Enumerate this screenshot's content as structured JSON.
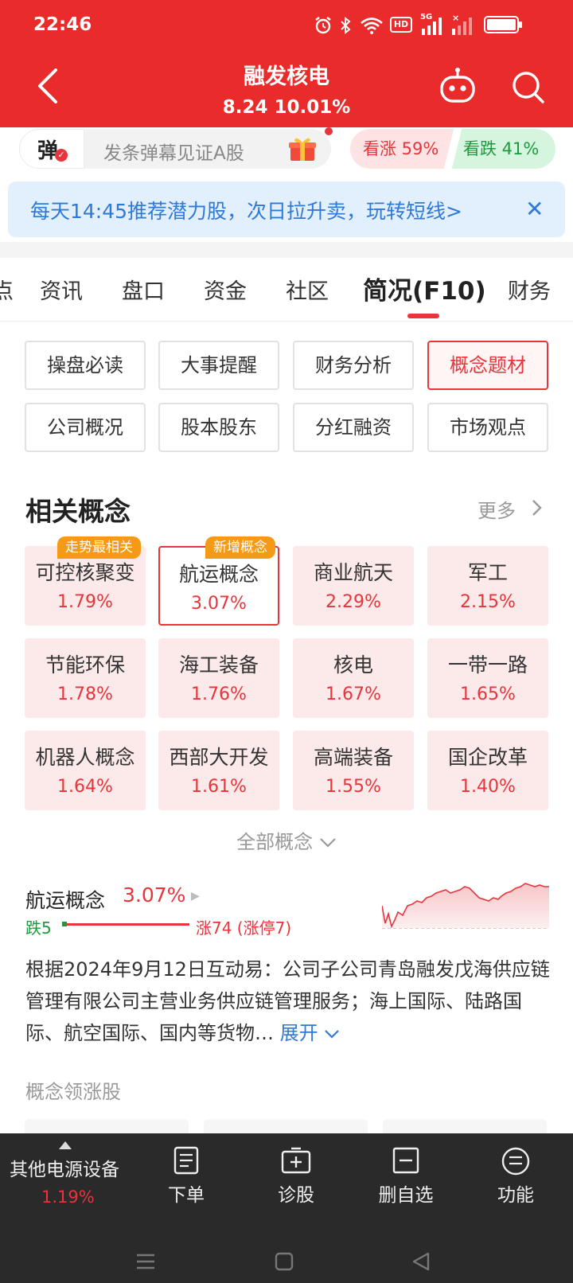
{
  "status_bar": {
    "time": "22:46",
    "icons": [
      "alarm-icon",
      "bluetooth-icon",
      "wifi-icon",
      "hd-icon",
      "signal-5g-icon",
      "signal-icon",
      "battery-icon"
    ],
    "hd_label": "HD",
    "net_label": "5G"
  },
  "header": {
    "stock_name": "融发核电",
    "quote": "8.24 10.01%",
    "bg_color": "#ea2b2b"
  },
  "danmaku": {
    "badge": "弹",
    "placeholder": "发条弹幕见证A股",
    "bullish": "看涨 59%",
    "bearish": "看跌 41%"
  },
  "promo": {
    "text": "每天14:45推荐潜力股，次日拉升卖，玩转短线>"
  },
  "tabs": [
    {
      "label": "点"
    },
    {
      "label": "资讯"
    },
    {
      "label": "盘口"
    },
    {
      "label": "资金"
    },
    {
      "label": "社区"
    },
    {
      "label": "简况(F10)"
    },
    {
      "label": "财务"
    }
  ],
  "f10_buttons": [
    {
      "label": "操盘必读"
    },
    {
      "label": "大事提醒"
    },
    {
      "label": "财务分析"
    },
    {
      "label": "概念题材"
    },
    {
      "label": "公司概况"
    },
    {
      "label": "股本股东"
    },
    {
      "label": "分红融资"
    },
    {
      "label": "市场观点"
    }
  ],
  "concepts_section": {
    "title": "相关概念",
    "more": "更多",
    "all_label": "全部概念",
    "cards": [
      {
        "name": "可控核聚变",
        "pct": "1.79%",
        "tag": "走势最相关"
      },
      {
        "name": "航运概念",
        "pct": "3.07%",
        "tag": "新增概念"
      },
      {
        "name": "商业航天",
        "pct": "2.29%"
      },
      {
        "name": "军工",
        "pct": "2.15%"
      },
      {
        "name": "节能环保",
        "pct": "1.78%"
      },
      {
        "name": "海工装备",
        "pct": "1.76%"
      },
      {
        "name": "核电",
        "pct": "1.67%"
      },
      {
        "name": "一带一路",
        "pct": "1.65%"
      },
      {
        "name": "机器人概念",
        "pct": "1.64%"
      },
      {
        "name": "西部大开发",
        "pct": "1.61%"
      },
      {
        "name": "高端装备",
        "pct": "1.55%"
      },
      {
        "name": "国企改革",
        "pct": "1.40%"
      }
    ]
  },
  "concept_detail": {
    "name": "航运概念",
    "pct": "3.07%",
    "fall": "跌5",
    "rise": "涨74 (涨停7)",
    "description": "根据2024年9月12日互动易：公司子公司青岛融发戊海供应链管理有限公司主营业务供应链管理服务；海上国际、陆路国际、航空国际、国内等货物…",
    "expand": "展开"
  },
  "leaders": {
    "title": "概念领涨股"
  },
  "bottom_bar": {
    "sector_name": "其他电源设备",
    "sector_pct": "1.19%",
    "nav": [
      {
        "label": "下单",
        "icon": "order-icon"
      },
      {
        "label": "诊股",
        "icon": "diagnose-icon"
      },
      {
        "label": "删自选",
        "icon": "remove-watchlist-icon"
      },
      {
        "label": "功能",
        "icon": "menu-icon"
      }
    ]
  },
  "colors": {
    "red": "#e8343a",
    "green": "#1e9a3e",
    "blue": "#2f7ad7",
    "tag_orange": "#f59a17"
  }
}
